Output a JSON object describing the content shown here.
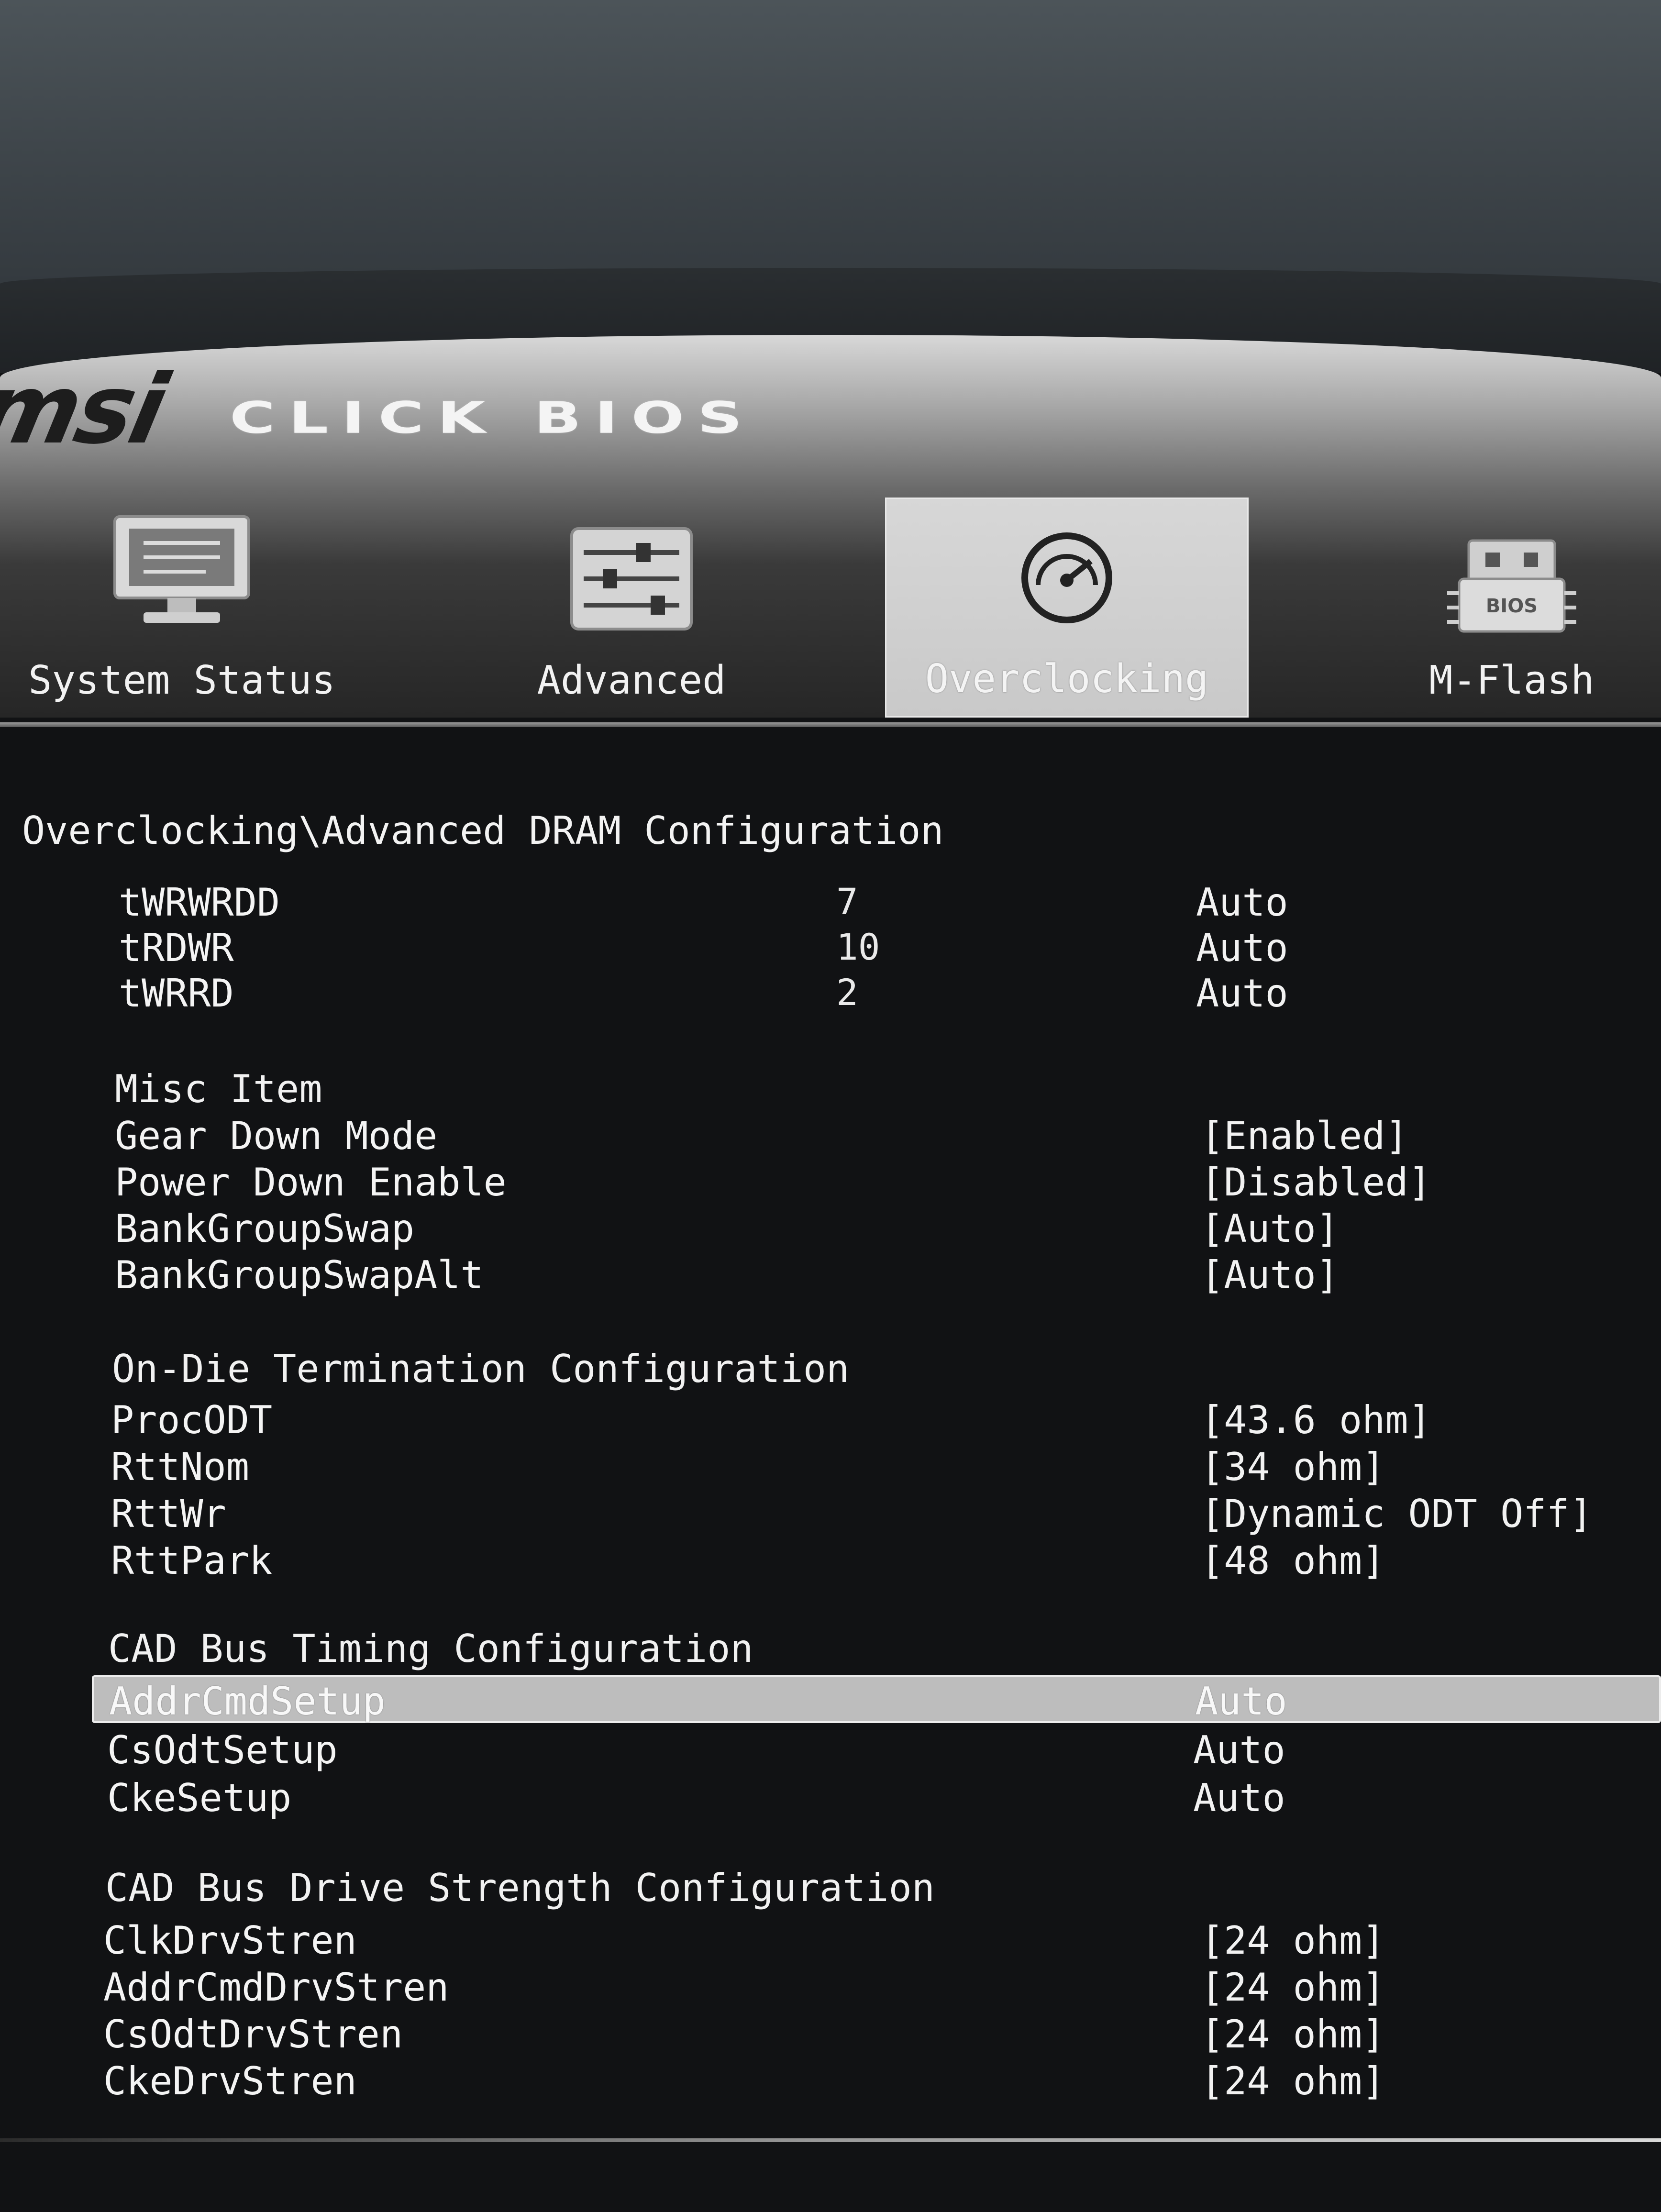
{
  "header": {
    "logo": "msi",
    "brand": "CLICK BIOS"
  },
  "tabs": [
    {
      "label": "System Status",
      "icon": "monitor-icon",
      "active": false
    },
    {
      "label": "Advanced",
      "icon": "sliders-icon",
      "active": false
    },
    {
      "label": "Overclocking",
      "icon": "speedometer-icon",
      "active": true
    },
    {
      "label": "M-Flash",
      "icon": "bios-chip-icon",
      "active": false
    }
  ],
  "breadcrumb": "Overclocking\\Advanced DRAM Configuration",
  "timings": [
    {
      "name": "tWRWRDD",
      "current": "7",
      "value": "Auto"
    },
    {
      "name": "tRDWR",
      "current": "10",
      "value": "Auto"
    },
    {
      "name": "tWRRD",
      "current": "2",
      "value": "Auto"
    }
  ],
  "misc": {
    "heading": "Misc Item",
    "items": [
      {
        "name": "Gear Down Mode",
        "value": "[Enabled]"
      },
      {
        "name": "Power Down Enable",
        "value": "[Disabled]"
      },
      {
        "name": "BankGroupSwap",
        "value": "[Auto]"
      },
      {
        "name": "BankGroupSwapAlt",
        "value": "[Auto]"
      }
    ]
  },
  "odt": {
    "heading": "On-Die Termination Configuration",
    "items": [
      {
        "name": "ProcODT",
        "value": "[43.6 ohm]"
      },
      {
        "name": "RttNom",
        "value": "[34 ohm]"
      },
      {
        "name": "RttWr",
        "value": "[Dynamic ODT Off]"
      },
      {
        "name": "RttPark",
        "value": "[48 ohm]"
      }
    ]
  },
  "cad_timing": {
    "heading": "CAD Bus Timing Configuration",
    "items": [
      {
        "name": "AddrCmdSetup",
        "value": "Auto",
        "selected": true
      },
      {
        "name": "CsOdtSetup",
        "value": "Auto"
      },
      {
        "name": "CkeSetup",
        "value": "Auto"
      }
    ]
  },
  "cad_drive": {
    "heading": "CAD Bus Drive Strength Configuration",
    "items": [
      {
        "name": "ClkDrvStren",
        "value": "[24 ohm]"
      },
      {
        "name": "AddrCmdDrvStren",
        "value": "[24 ohm]"
      },
      {
        "name": "CsOdtDrvStren",
        "value": "[24 ohm]"
      },
      {
        "name": "CkeDrvStren",
        "value": "[24 ohm]"
      }
    ]
  }
}
